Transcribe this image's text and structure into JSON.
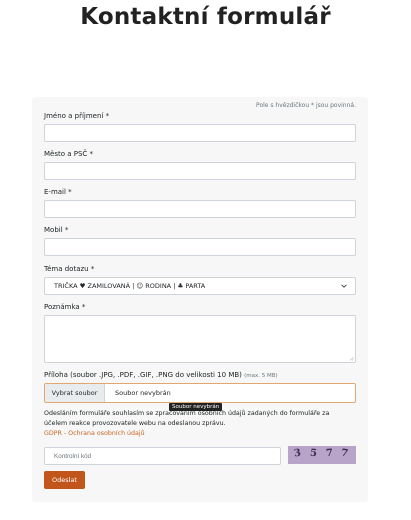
{
  "page_title": "Kontaktní formulář",
  "form": {
    "required_note": "Pole s hvězdičkou * jsou povinná.",
    "fields": {
      "name": {
        "label": "Jméno a příjmení *",
        "value": ""
      },
      "city": {
        "label": "Město a PSČ *",
        "value": ""
      },
      "email": {
        "label": "E-mail *",
        "value": ""
      },
      "mobile": {
        "label": "Mobil *",
        "value": ""
      }
    },
    "topic": {
      "label": "Téma dotazu *",
      "selected": "TRIČKA ♥ ZAMILOVANÁ | ☺ RODINA | ♣ PARTA"
    },
    "note": {
      "label": "Poznámka *",
      "value": ""
    },
    "attachment": {
      "label": "Příloha (soubor .JPG, .PDF, .GIF, .PNG do velikosti 10 MB)",
      "max_note": "(max. 5 MB)",
      "button_label": "Vybrat soubor",
      "status": "Soubor nevybrán",
      "tooltip": "Soubor nevybrán"
    },
    "consent_text": "Odesláním formuláře souhlasím se zpracováním osobních údajů zadaných do formuláře za účelem reakce provozovatele webu na odeslanou zprávu.",
    "gdpr_link": "GDPR - Ochrana osobních údajů",
    "captcha": {
      "placeholder": "Kontrolní kód",
      "code": [
        "3",
        "5",
        "7",
        "7"
      ]
    },
    "submit_label": "Odeslat"
  },
  "colors": {
    "accent": "#c1551c",
    "link": "#c8672a",
    "card_bg": "#f6f7f6"
  }
}
